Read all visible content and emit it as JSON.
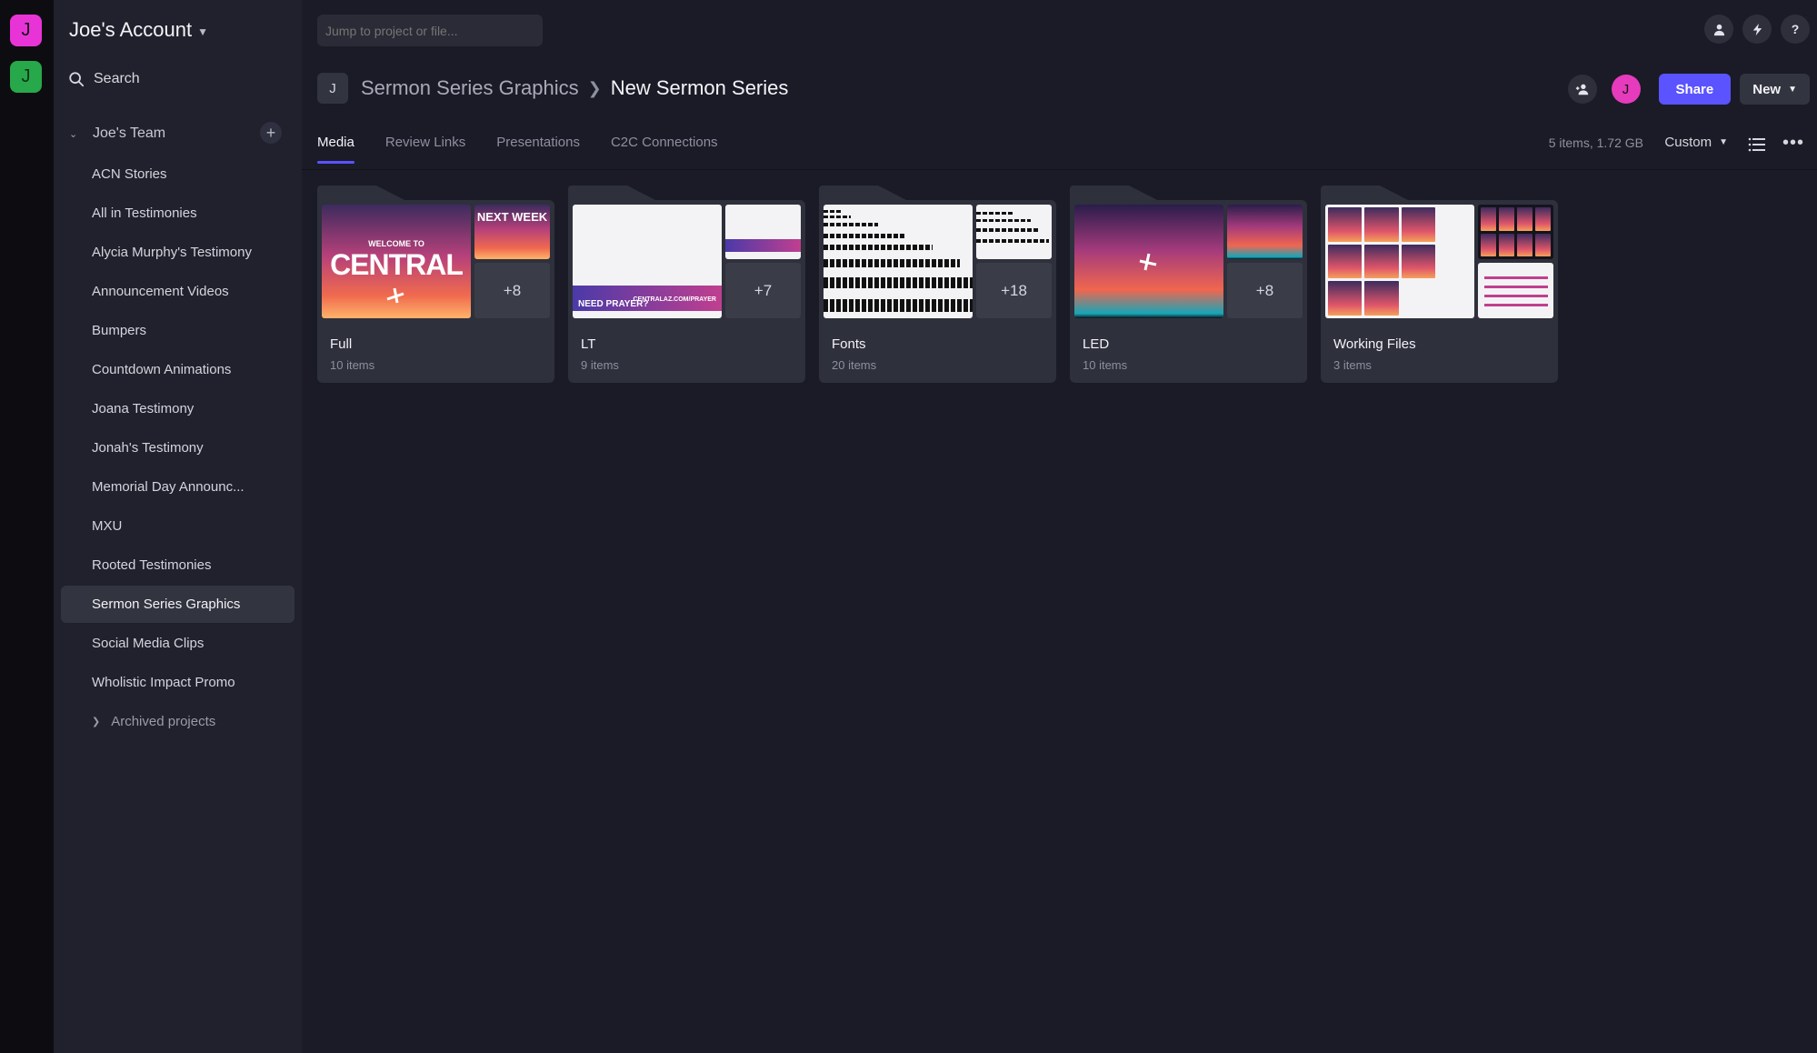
{
  "rail": {
    "workspace_a": "J",
    "workspace_b": "J"
  },
  "sidebar": {
    "account_name": "Joe's Account",
    "search_label": "Search",
    "team_name": "Joe's Team",
    "projects": [
      "ACN Stories",
      "All in Testimonies",
      "Alycia Murphy's Testimony",
      "Announcement Videos",
      "Bumpers",
      "Countdown Animations",
      "Joana Testimony",
      "Jonah's Testimony",
      "Memorial Day Announc...",
      "MXU",
      "Rooted Testimonies",
      "Sermon Series Graphics",
      "Social Media Clips",
      "Wholistic Impact Promo"
    ],
    "active_project": "Sermon Series Graphics",
    "archived_label": "Archived projects"
  },
  "header": {
    "jump_placeholder": "Jump to project or file...",
    "project_badge": "J",
    "breadcrumb_parent": "Sermon Series Graphics",
    "breadcrumb_current": "New Sermon Series",
    "user_avatar": "J",
    "share_label": "Share",
    "new_label": "New"
  },
  "tabs": [
    "Media",
    "Review Links",
    "Presentations",
    "C2C Connections"
  ],
  "active_tab": "Media",
  "toolbar": {
    "summary": "5 items, 1.72 GB",
    "sort_label": "Custom"
  },
  "folders": [
    {
      "name": "Full",
      "count": "10 items",
      "more": "+8",
      "thumb_text": {
        "welcome": "WELCOME TO",
        "central": "CENTRAL",
        "next_week": "NEXT WEEK"
      }
    },
    {
      "name": "LT",
      "count": "9 items",
      "more": "+7",
      "thumb_text": {
        "prayer": "NEED PRAYER?",
        "url": "CENTRALAZ.COM/PRAYER"
      }
    },
    {
      "name": "Fonts",
      "count": "20 items",
      "more": "+18"
    },
    {
      "name": "LED",
      "count": "10 items",
      "more": "+8"
    },
    {
      "name": "Working Files",
      "count": "3 items",
      "more": ""
    }
  ],
  "colors": {
    "accent": "#5b53ff",
    "avatar_pink": "#e834d7",
    "avatar_green": "#27a84a"
  }
}
